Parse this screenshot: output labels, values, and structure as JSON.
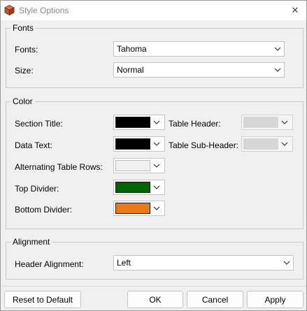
{
  "window": {
    "title": "Style Options",
    "close_glyph": "✕"
  },
  "fonts": {
    "legend": "Fonts",
    "font_label": "Fonts:",
    "font_value": "Tahoma",
    "size_label": "Size:",
    "size_value": "Normal"
  },
  "color": {
    "legend": "Color",
    "section_title": {
      "label": "Section Title:",
      "color": "#000000"
    },
    "data_text": {
      "label": "Data Text:",
      "color": "#000000"
    },
    "alternating_rows": {
      "label": "Alternating Table Rows:",
      "color": "#f0f0f0"
    },
    "top_divider": {
      "label": "Top Divider:",
      "color": "#006400"
    },
    "bottom_divider": {
      "label": "Bottom Divider:",
      "color": "#ea7a16"
    },
    "table_header": {
      "label": "Table Header:",
      "color": "#d6d6d6"
    },
    "table_subheader": {
      "label": "Table Sub-Header:",
      "color": "#d6d6d6"
    }
  },
  "alignment": {
    "legend": "Alignment",
    "header_label": "Header Alignment:",
    "header_value": "Left"
  },
  "buttons": {
    "reset": "Reset to Default",
    "ok": "OK",
    "cancel": "Cancel",
    "apply": "Apply"
  },
  "icons": [
    "app-icon",
    "close-icon",
    "chevron-down-icon"
  ]
}
